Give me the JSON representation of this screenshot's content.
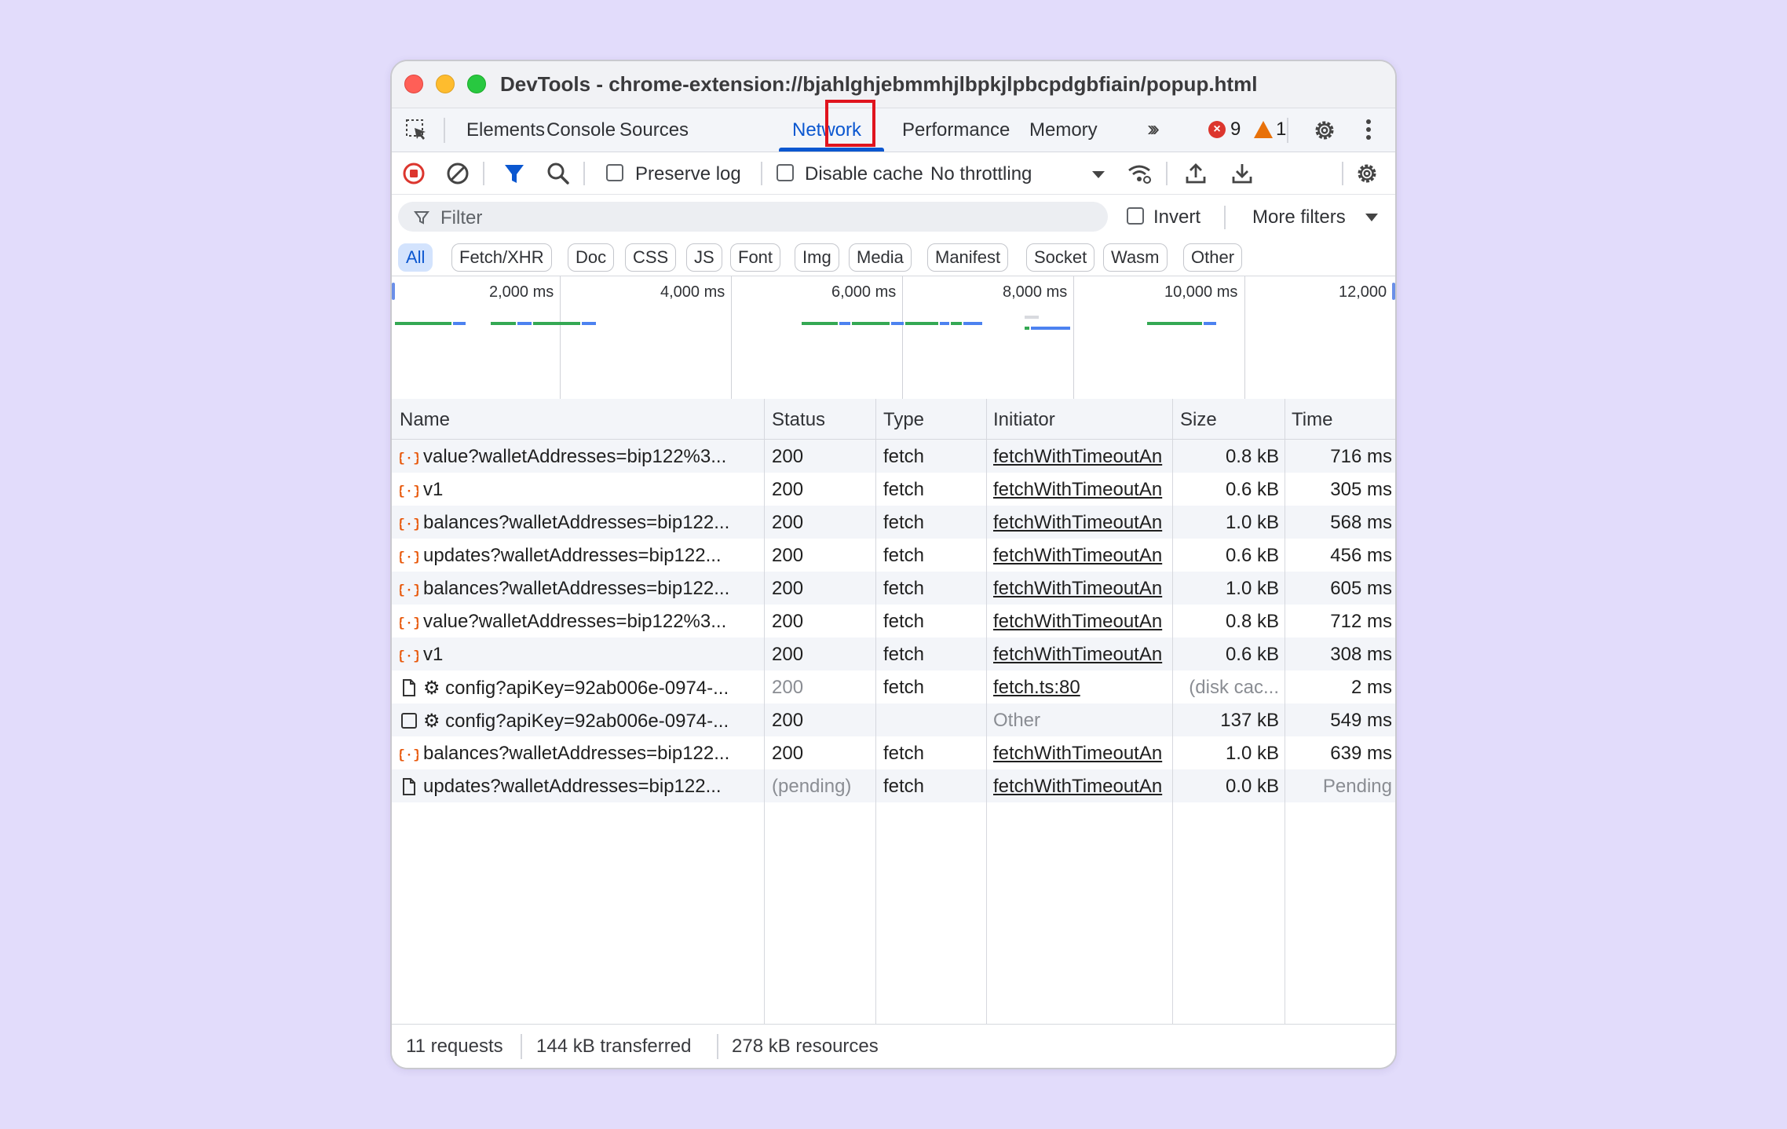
{
  "window": {
    "title": "DevTools - chrome-extension://bjahlghjebmmhjlbpkjlpbcpdgbfiain/popup.html"
  },
  "tabs": [
    {
      "label": "Elements"
    },
    {
      "label": "Console"
    },
    {
      "label": "Sources"
    },
    {
      "label": "Network",
      "active": true
    },
    {
      "label": "Performance"
    },
    {
      "label": "Memory"
    }
  ],
  "badges": {
    "errors": "9",
    "warnings": "1"
  },
  "toolbar": {
    "preserve_log": "Preserve log",
    "disable_cache": "Disable cache",
    "throttling": "No throttling"
  },
  "filter": {
    "placeholder": "Filter",
    "invert": "Invert",
    "more_filters": "More filters"
  },
  "type_filters": [
    "All",
    "Fetch/XHR",
    "Doc",
    "CSS",
    "JS",
    "Font",
    "Img",
    "Media",
    "Manifest",
    "Socket",
    "Wasm",
    "Other"
  ],
  "overview": {
    "ticks": [
      "2,000 ms",
      "4,000 ms",
      "6,000 ms",
      "8,000 ms",
      "10,000 ms",
      "12,000"
    ]
  },
  "table": {
    "columns": [
      "Name",
      "Status",
      "Type",
      "Initiator",
      "Size",
      "Time"
    ],
    "rows": [
      {
        "icon": "fetch-icon",
        "name": "value?walletAddresses=bip122%3...",
        "status": "200",
        "type": "fetch",
        "initiator": "fetchWithTimeoutAn",
        "size": "0.8 kB",
        "time": "716 ms"
      },
      {
        "icon": "fetch-icon",
        "name": "v1",
        "status": "200",
        "type": "fetch",
        "initiator": "fetchWithTimeoutAn",
        "size": "0.6 kB",
        "time": "305 ms"
      },
      {
        "icon": "fetch-icon",
        "name": "balances?walletAddresses=bip122...",
        "status": "200",
        "type": "fetch",
        "initiator": "fetchWithTimeoutAn",
        "size": "1.0 kB",
        "time": "568 ms"
      },
      {
        "icon": "fetch-icon",
        "name": "updates?walletAddresses=bip122...",
        "status": "200",
        "type": "fetch",
        "initiator": "fetchWithTimeoutAn",
        "size": "0.6 kB",
        "time": "456 ms"
      },
      {
        "icon": "fetch-icon",
        "name": "balances?walletAddresses=bip122...",
        "status": "200",
        "type": "fetch",
        "initiator": "fetchWithTimeoutAn",
        "size": "1.0 kB",
        "time": "605 ms"
      },
      {
        "icon": "fetch-icon",
        "name": "value?walletAddresses=bip122%3...",
        "status": "200",
        "type": "fetch",
        "initiator": "fetchWithTimeoutAn",
        "size": "0.8 kB",
        "time": "712 ms"
      },
      {
        "icon": "fetch-icon",
        "name": "v1",
        "status": "200",
        "type": "fetch",
        "initiator": "fetchWithTimeoutAn",
        "size": "0.6 kB",
        "time": "308 ms"
      },
      {
        "icon": "document-icon",
        "name": "⚙ config?apiKey=92ab006e-0974-...",
        "status": "200",
        "type": "fetch",
        "initiator": "fetch.ts:80",
        "size": "(disk cac...",
        "time": "2 ms",
        "dim_status": true,
        "dim_size": true
      },
      {
        "icon": "checkbox-icon",
        "name": "⚙ config?apiKey=92ab006e-0974-...",
        "status": "200",
        "type": "",
        "initiator": "Other",
        "size": "137 kB",
        "time": "549 ms",
        "dim_initiator": true,
        "plain_initiator": true
      },
      {
        "icon": "fetch-icon",
        "name": "balances?walletAddresses=bip122...",
        "status": "200",
        "type": "fetch",
        "initiator": "fetchWithTimeoutAn",
        "size": "1.0 kB",
        "time": "639 ms"
      },
      {
        "icon": "document-icon",
        "name": "updates?walletAddresses=bip122...",
        "status": "(pending)",
        "type": "fetch",
        "initiator": "fetchWithTimeoutAn",
        "size": "0.0 kB",
        "time": "Pending",
        "dim_status": true,
        "dim_time": true
      }
    ]
  },
  "status_bar": {
    "requests": "11 requests",
    "transferred": "144 kB transferred",
    "resources": "278 kB resources"
  },
  "colors": {
    "accent": "#0b57d0",
    "error": "#dc362e",
    "warning": "#e8710a",
    "fetch_icon": "#e8590c",
    "timeline_green": "#34a853",
    "timeline_blue": "#4c82f0",
    "highlight": "#e0141e"
  }
}
